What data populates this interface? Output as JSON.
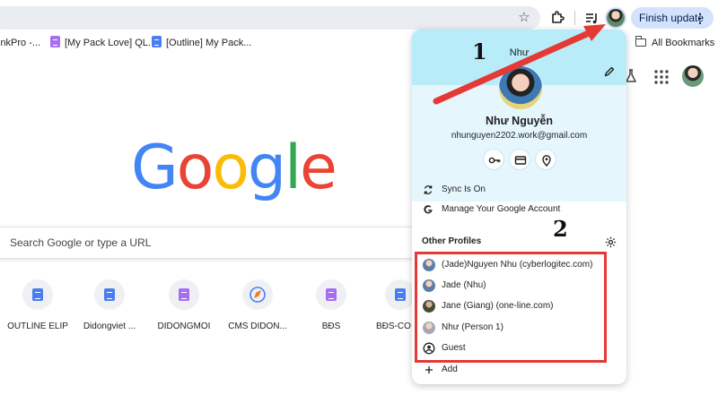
{
  "toolbar": {
    "finish_update_label": "Finish update",
    "kebab": "⋮",
    "star": "☆"
  },
  "bookmarks": {
    "items": [
      {
        "label": "inkPro -...",
        "icon": "none"
      },
      {
        "label": "[My Pack Love] QL...",
        "icon": "purple-doc-icon"
      },
      {
        "label": "[Outline] My Pack...",
        "icon": "blue-doc-icon"
      }
    ],
    "all_bookmarks": "All Bookmarks"
  },
  "google": {
    "logo": [
      "G",
      "o",
      "o",
      "g",
      "l",
      "e"
    ],
    "search_placeholder": "Search Google or type a URL"
  },
  "shortcuts": [
    {
      "label": "OUTLINE ELIP",
      "icon": "blue-doc-icon"
    },
    {
      "label": "Didongviet ...",
      "icon": "blue-doc-icon"
    },
    {
      "label": "DIDONGMOI",
      "icon": "purple-doc-icon"
    },
    {
      "label": "CMS DIDON...",
      "icon": "compass-icon"
    },
    {
      "label": "BĐS",
      "icon": "purple-doc-icon"
    },
    {
      "label": "BĐS-CO",
      "icon": "blue-doc-icon"
    }
  ],
  "profile_panel": {
    "top_name": "Như",
    "full_name": "Như Nguyễn",
    "email": "nhunguyen2202.work@gmail.com",
    "quick_actions": [
      "key-icon",
      "card-icon",
      "location-icon"
    ],
    "sync_label": "Sync Is On",
    "manage_account_label": "Manage Your Google Account",
    "other_profiles_heading": "Other Profiles",
    "other_profiles": [
      {
        "label": "(Jade)Nguyen Nhu (cyberlogitec.com)",
        "avatar": "avatar-a"
      },
      {
        "label": "Jade (Nhu)",
        "avatar": "avatar-a"
      },
      {
        "label": "Jane (Giang) (one-line.com)",
        "avatar": "avatar-b"
      },
      {
        "label": "Như (Person 1)",
        "avatar": "avatar-c"
      },
      {
        "label": "Guest",
        "avatar": "guest-icon"
      }
    ],
    "add_label": "Add"
  },
  "annotations": {
    "step1": "1",
    "step2": "2",
    "color": "#e53935"
  }
}
